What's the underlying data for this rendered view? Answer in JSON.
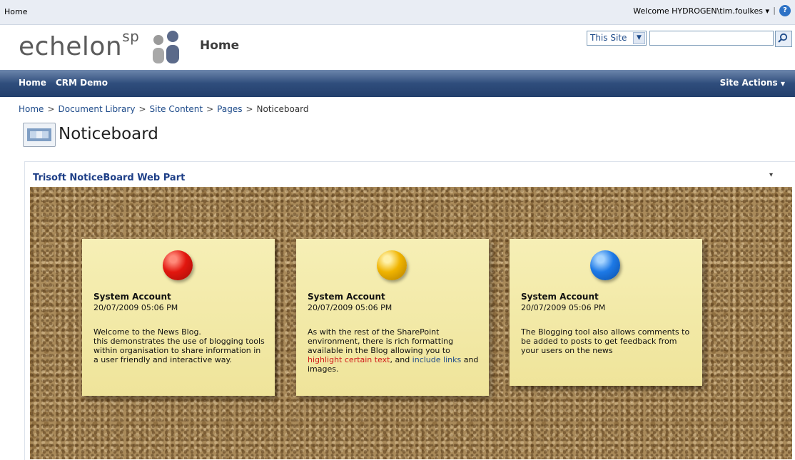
{
  "topbar": {
    "home": "Home",
    "welcome": "Welcome HYDROGEN\\tim.foulkes",
    "welcome_arrow": "▾",
    "separator": "|",
    "help_icon": "?"
  },
  "header": {
    "logo_text": "echelon",
    "logo_sup": "sp",
    "title": "Home",
    "search_scope": "This Site",
    "search_placeholder": ""
  },
  "nav": {
    "items": [
      "Home",
      "CRM Demo"
    ],
    "site_actions": "Site Actions"
  },
  "breadcrumb": {
    "items": [
      "Home",
      "Document Library",
      "Site Content",
      "Pages"
    ],
    "current": "Noticeboard",
    "separator": ">"
  },
  "page": {
    "title": "Noticeboard"
  },
  "webpart": {
    "title": "Trisoft NoticeBoard Web Part",
    "menu_icon": "▾",
    "notes": [
      {
        "pin_color": "#e2170f",
        "author": "System Account",
        "date": "20/07/2009 05:06 PM",
        "lines": [
          "Welcome to the News Blog.",
          "this demonstrates the use of blogging tools within organisation to share information in a user friendly and interactive way."
        ]
      },
      {
        "pin_color": "#f0b400",
        "author": "System Account",
        "date": "20/07/2009 05:06 PM",
        "text_pre": "As with the rest of the SharePoint environment, there is rich formatting available in the Blog allowing you to ",
        "highlight": "highlight certain text",
        "text_mid": ", and ",
        "link": "include links",
        "text_post": " and images."
      },
      {
        "pin_color": "#1d79e6",
        "author": "System Account",
        "date": "20/07/2009 05:06 PM",
        "text": "The Blogging tool also allows comments to be added to posts to get feedback from your users on the news"
      }
    ]
  }
}
